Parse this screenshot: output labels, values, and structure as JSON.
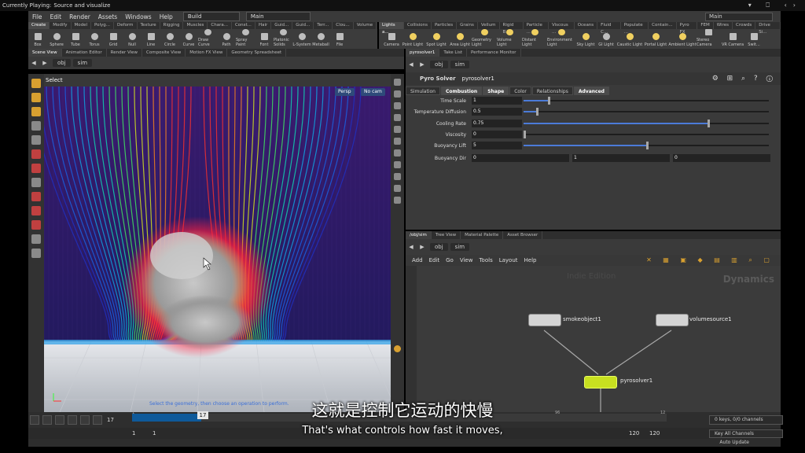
{
  "now_playing": {
    "label": "Currently Playing:",
    "title": "Source and visualize"
  },
  "menu": {
    "items": [
      "File",
      "Edit",
      "Render",
      "Assets",
      "Windows",
      "Help"
    ],
    "desktop": "Build",
    "session": "Main",
    "right_session": "Main"
  },
  "shelf_left": {
    "tabs": [
      "Create",
      "Modify",
      "Model",
      "Polyg...",
      "Deform",
      "Texture",
      "Rigging",
      "Muscles",
      "Chara...",
      "Const...",
      "Hair",
      "Guid...",
      "Guid...",
      "Terr...",
      "Clou...",
      "Volume"
    ],
    "tools": [
      "Box",
      "Sphere",
      "Tube",
      "Torus",
      "Grid",
      "Null",
      "Line",
      "Circle",
      "Curve",
      "Draw Curve",
      "Path",
      "Spray Paint",
      "Font",
      "Platonic Solids",
      "L-System",
      "Metaball",
      "File"
    ]
  },
  "shelf_right": {
    "tabs": [
      "Lights a...",
      "Collisions",
      "Particles",
      "Grains",
      "Vellum",
      "Rigid B...",
      "Particle ...",
      "Viscous ...",
      "Oceans",
      "Fluid C...",
      "Populate ...",
      "Contain...",
      "Pyro FX",
      "FEM",
      "Wires",
      "Crowds",
      "Drive Si..."
    ],
    "tools": [
      "Camera",
      "Point Light",
      "Spot Light",
      "Area Light",
      "Geometry Light",
      "Volume Light",
      "Distant Light",
      "Environment Light",
      "Sky Light",
      "GI Light",
      "Caustic Light",
      "Portal Light",
      "Ambient Light",
      "Stereo Camera",
      "VR Camera",
      "Swit..."
    ]
  },
  "left_pane": {
    "tabs": [
      "Scene View",
      "Animation Editor",
      "Render View",
      "Composite View",
      "Motion FX View",
      "Geometry Spreadsheet"
    ],
    "path": [
      "obj",
      "sim"
    ],
    "mode": "Select",
    "persp": "Persp",
    "cam": "No cam",
    "hint": "Select the geometry, then choose an operation to perform."
  },
  "param_pane": {
    "tabs": [
      "pyrosolver1",
      "Take List",
      "Performance Monitor"
    ],
    "path": [
      "obj",
      "sim"
    ],
    "node_type": "Pyro Solver",
    "node_name": "pyrosolver1",
    "ptabs": [
      "Simulation",
      "Combustion",
      "Shape",
      "Color",
      "Relationships",
      "Advanced"
    ],
    "params": [
      {
        "label": "Time Scale",
        "value": "1",
        "fill": 0.1
      },
      {
        "label": "Temperature Diffusion",
        "value": "0.5",
        "fill": 0.05
      },
      {
        "label": "Cooling Rate",
        "value": "0.75",
        "fill": 0.75
      },
      {
        "label": "Viscosity",
        "value": "0",
        "fill": 0.0
      },
      {
        "label": "Buoyancy Lift",
        "value": "5",
        "fill": 0.5
      }
    ],
    "buoyancy_dir": {
      "label": "Buoyancy Dir",
      "values": [
        "0",
        "1",
        "0"
      ]
    }
  },
  "network": {
    "tabs": [
      "/obj/sim",
      "Tree View",
      "Material Palette",
      "Asset Browser"
    ],
    "path": [
      "obj",
      "sim"
    ],
    "menu": [
      "Add",
      "Edit",
      "Go",
      "View",
      "Tools",
      "Layout",
      "Help"
    ],
    "edition": "Indie Edition",
    "context": "Dynamics",
    "nodes": [
      "smokeobject1",
      "volumesource1",
      "pyrosolver1"
    ]
  },
  "timeline": {
    "frame": "17",
    "current": "17",
    "start": "1",
    "start2": "1",
    "end": "120",
    "end2": "120",
    "ticks": [
      "1",
      "96",
      "12"
    ],
    "keys": "0 keys, 0/0 channels",
    "key_all": "Key All Channels",
    "auto_update": "Auto Update"
  },
  "subtitle": {
    "cn": "这就是控制它运动的快慢",
    "en": "That's what controls how fast it moves,"
  },
  "colors": {
    "accent": "#4b7bd8",
    "node_selected": "#c8e020"
  }
}
